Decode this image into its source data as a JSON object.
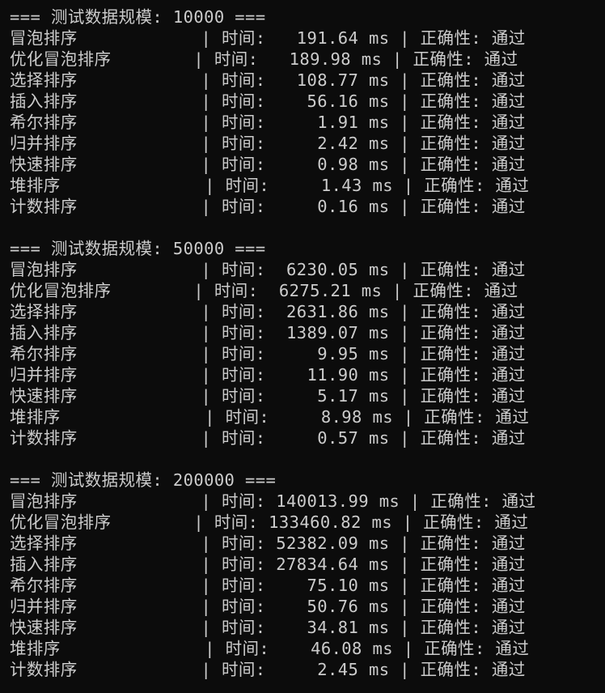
{
  "colors": {
    "background": "#0c0c0c",
    "foreground": "#cccccc"
  },
  "lines": [
    "=== 测试数据规模: 10000 ===",
    "冒泡排序            | 时间:   191.64 ms | 正确性: 通过",
    "优化冒泡排序        | 时间:   189.98 ms | 正确性: 通过",
    "选择排序            | 时间:   108.77 ms | 正确性: 通过",
    "插入排序            | 时间:    56.16 ms | 正确性: 通过",
    "希尔排序            | 时间:     1.91 ms | 正确性: 通过",
    "归并排序            | 时间:     2.42 ms | 正确性: 通过",
    "快速排序            | 时间:     0.98 ms | 正确性: 通过",
    "堆排序              | 时间:     1.43 ms | 正确性: 通过",
    "计数排序            | 时间:     0.16 ms | 正确性: 通过",
    "",
    "=== 测试数据规模: 50000 ===",
    "冒泡排序            | 时间:  6230.05 ms | 正确性: 通过",
    "优化冒泡排序        | 时间:  6275.21 ms | 正确性: 通过",
    "选择排序            | 时间:  2631.86 ms | 正确性: 通过",
    "插入排序            | 时间:  1389.07 ms | 正确性: 通过",
    "希尔排序            | 时间:     9.95 ms | 正确性: 通过",
    "归并排序            | 时间:    11.90 ms | 正确性: 通过",
    "快速排序            | 时间:     5.17 ms | 正确性: 通过",
    "堆排序              | 时间:     8.98 ms | 正确性: 通过",
    "计数排序            | 时间:     0.57 ms | 正确性: 通过",
    "",
    "=== 测试数据规模: 200000 ===",
    "冒泡排序            | 时间: 140013.99 ms | 正确性: 通过",
    "优化冒泡排序        | 时间: 133460.82 ms | 正确性: 通过",
    "选择排序            | 时间: 52382.09 ms | 正确性: 通过",
    "插入排序            | 时间: 27834.64 ms | 正确性: 通过",
    "希尔排序            | 时间:    75.10 ms | 正确性: 通过",
    "归并排序            | 时间:    50.76 ms | 正确性: 通过",
    "快速排序            | 时间:    34.81 ms | 正确性: 通过",
    "堆排序              | 时间:    46.08 ms | 正确性: 通过",
    "计数排序            | 时间:     2.45 ms | 正确性: 通过"
  ]
}
